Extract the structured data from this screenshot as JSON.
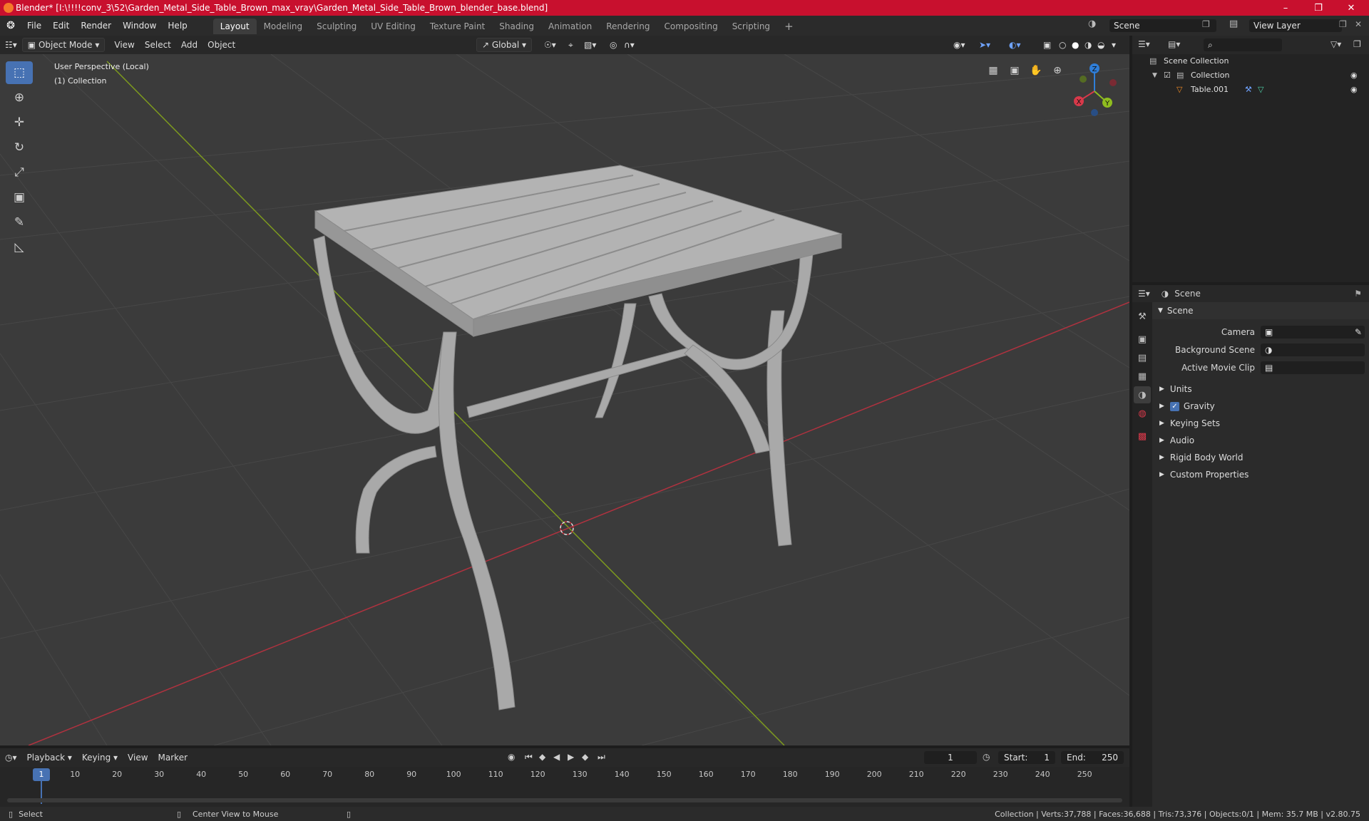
{
  "window": {
    "title": "Blender* [I:\\!!!!conv_3\\52\\Garden_Metal_Side_Table_Brown_max_vray\\Garden_Metal_Side_Table_Brown_blender_base.blend]",
    "minimize_icon": "minimize-icon",
    "maximize_icon": "maximize-icon",
    "close_icon": "close-icon"
  },
  "menu": [
    "File",
    "Edit",
    "Render",
    "Window",
    "Help"
  ],
  "workspaces": [
    "Layout",
    "Modeling",
    "Sculpting",
    "UV Editing",
    "Texture Paint",
    "Shading",
    "Animation",
    "Rendering",
    "Compositing",
    "Scripting"
  ],
  "active_workspace": "Layout",
  "scene_selector": "Scene",
  "view_layer_selector": "View Layer",
  "viewport": {
    "mode": "Object Mode",
    "menus": [
      "View",
      "Select",
      "Add",
      "Object"
    ],
    "orientation": "Global",
    "overlay_line1": "User Perspective (Local)",
    "overlay_line2": "(1) Collection",
    "gizmo_labels": {
      "x": "X",
      "y": "Y",
      "z": "Z"
    }
  },
  "outliner": {
    "root": "Scene Collection",
    "collection": "Collection",
    "object": "Table.001"
  },
  "properties": {
    "context": "Scene",
    "panel_title": "Scene",
    "camera_label": "Camera",
    "camera_value": "",
    "background_scene_label": "Background Scene",
    "background_scene_value": "",
    "movie_clip_label": "Active Movie Clip",
    "movie_clip_value": "",
    "sections": [
      "Units",
      "Gravity",
      "Keying Sets",
      "Audio",
      "Rigid Body World",
      "Custom Properties"
    ],
    "gravity_checked": true
  },
  "timeline": {
    "menus": [
      "Playback",
      "Keying",
      "View",
      "Marker"
    ],
    "current_frame": "1",
    "start_label": "Start:",
    "start": "1",
    "end_label": "End:",
    "end": "250",
    "ticks": [
      "10",
      "20",
      "30",
      "40",
      "50",
      "60",
      "70",
      "80",
      "90",
      "100",
      "110",
      "120",
      "130",
      "140",
      "150",
      "160",
      "170",
      "180",
      "190",
      "200",
      "210",
      "220",
      "230",
      "240",
      "250"
    ],
    "playhead": "1"
  },
  "status": {
    "left_action": "Select",
    "mid_action": "Center View to Mouse",
    "stats": "Collection | Verts:37,788 | Faces:36,688 | Tris:73,376 | Objects:0/1 | Mem: 35.7 MB | v2.80.75"
  },
  "colors": {
    "titlebar": "#c8102e",
    "accent": "#4772b3",
    "x_axis": "#d8394a",
    "y_axis": "#8fbd1f",
    "z_axis": "#2f7ed8",
    "model": "#a8a8a8"
  }
}
